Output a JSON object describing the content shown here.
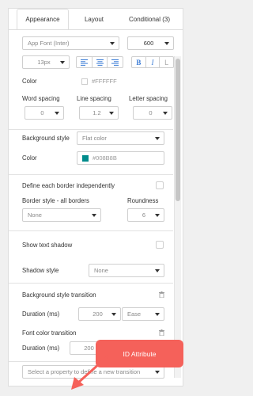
{
  "tabs": [
    {
      "label": "Appearance"
    },
    {
      "label": "Layout"
    },
    {
      "label": "Conditional (3)"
    }
  ],
  "font": {
    "family": "App Font (Inter)",
    "weight": "600",
    "size": "13px"
  },
  "align_icons": [
    "align-left-icon",
    "align-center-icon",
    "align-right-icon"
  ],
  "style_buttons": {
    "bold": "B",
    "italic": "I",
    "underline": "L"
  },
  "color": {
    "label": "Color",
    "value": "#FFFFFF",
    "swatch": "#FFFFFF"
  },
  "spacing": {
    "word_label": "Word spacing",
    "word_value": "0",
    "line_label": "Line spacing",
    "line_value": "1.2",
    "letter_label": "Letter spacing",
    "letter_value": "0"
  },
  "background": {
    "style_label": "Background style",
    "style_value": "Flat color",
    "color_label": "Color",
    "color_value": "#008B8B",
    "swatch": "#008B8B"
  },
  "border": {
    "define_label": "Define each border independently",
    "style_label": "Border style - all borders",
    "style_value": "None",
    "roundness_label": "Roundness",
    "roundness_value": "6"
  },
  "shadow": {
    "show_label": "Show text shadow",
    "style_label": "Shadow style",
    "style_value": "None"
  },
  "bg_transition": {
    "label": "Background style transition",
    "duration_label": "Duration (ms)",
    "duration_value": "200",
    "easing_value": "Ease"
  },
  "font_transition": {
    "label": "Font color transition",
    "duration_label": "Duration (ms)",
    "duration_value": "200"
  },
  "transition_placeholder": "Select a property to define a new transition",
  "callout": {
    "text": "ID Attribute",
    "color": "#F5615A"
  }
}
